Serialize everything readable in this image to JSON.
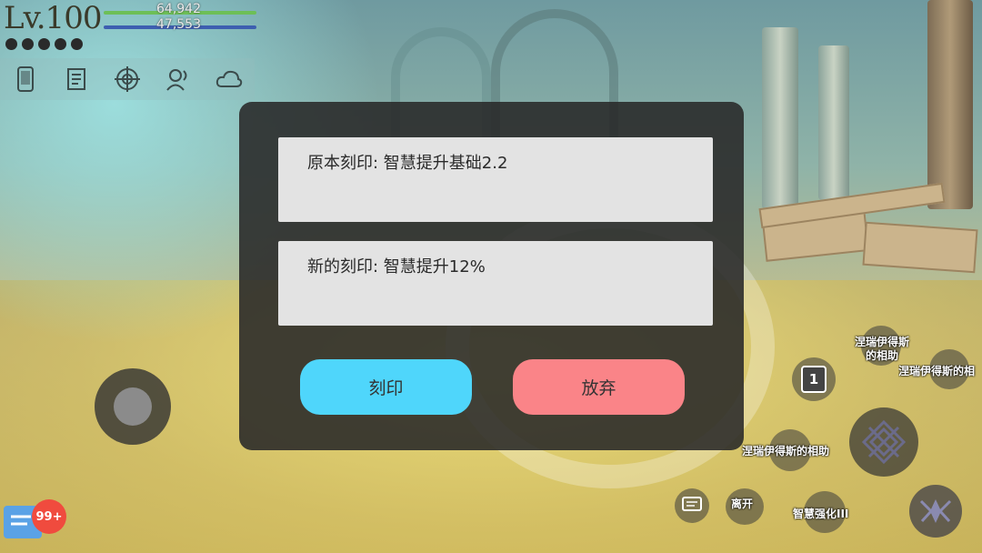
{
  "hud": {
    "level": "Lv.100",
    "hp_value": "64,942",
    "mp_value": "47,553",
    "icons": [
      "phone-icon",
      "quest-scroll-icon",
      "target-icon",
      "voice-chat-icon",
      "cloud-icon"
    ]
  },
  "engrave_dialog": {
    "original_engraving": "原本刻印: 智慧提升基础2.2",
    "new_engraving": "新的刻印: 智慧提升12%",
    "engrave_button": "刻印",
    "discard_button": "放弃"
  },
  "skills": {
    "skill_top_label": "涅瑞伊得斯\n的相助",
    "skill_right_label": "涅瑞伊得斯的相",
    "slot_number": "1",
    "skill_left_label": "涅瑞伊得斯的相助",
    "leave_label": "离开",
    "wisdom_boost_label": "智慧强化III"
  },
  "chat": {
    "unread_badge": "99+"
  },
  "colors": {
    "engrave_button": "#4fd6fb",
    "discard_button": "#fa8488",
    "dialog_bg": "#2a2a2a",
    "field_bg": "#e3e3e3"
  }
}
